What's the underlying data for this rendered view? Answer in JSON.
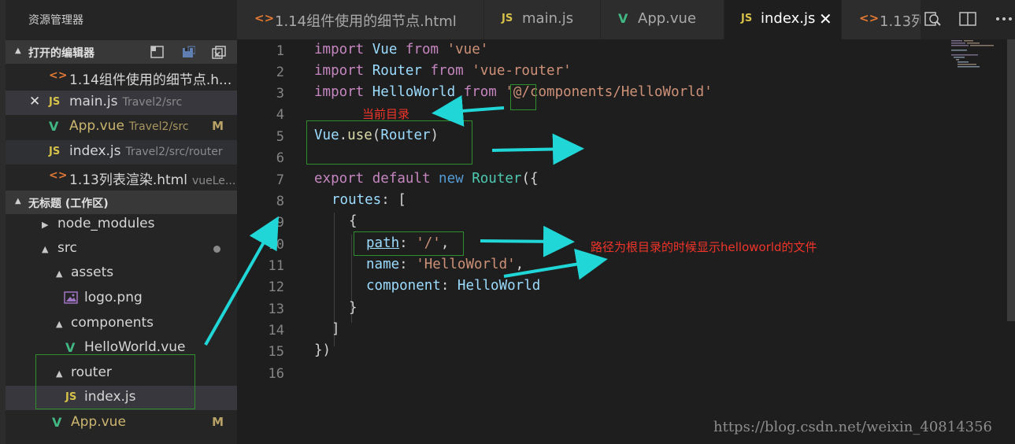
{
  "explorer": {
    "title": "资源管理器",
    "open_editors": {
      "label": "打开的编辑器",
      "items": [
        {
          "icon": "<>",
          "name": "1.14组件使用的细节点.h...",
          "desc": "",
          "badge": ""
        },
        {
          "icon": "JS",
          "name": "main.js",
          "desc": "Travel2/src",
          "badge": ""
        },
        {
          "icon": "V",
          "name": "App.vue",
          "desc": "Travel2/src",
          "badge": "M"
        },
        {
          "icon": "JS",
          "name": "index.js",
          "desc": "Travel2/src/router",
          "badge": ""
        },
        {
          "icon": "<>",
          "name": "1.13列表渲染.html",
          "desc": "vueLe...",
          "badge": ""
        }
      ]
    },
    "workspace": {
      "label": "无标题 (工作区)",
      "tree": [
        {
          "name": "node_modules",
          "expanded": false
        },
        {
          "name": "src",
          "expanded": true
        },
        {
          "name": "assets",
          "expanded": true
        },
        {
          "name": "logo.png",
          "icon": "image-icon"
        },
        {
          "name": "components",
          "expanded": true
        },
        {
          "name": "HelloWorld.vue",
          "icon": "V"
        },
        {
          "name": "router",
          "expanded": true
        },
        {
          "name": "index.js",
          "icon": "JS"
        },
        {
          "name": "App.vue",
          "icon": "V",
          "badge": "M"
        }
      ]
    }
  },
  "tabs": [
    {
      "icon": "<>",
      "label": "1.14组件使用的细节点.html"
    },
    {
      "icon": "JS",
      "label": "main.js"
    },
    {
      "icon": "V",
      "label": "App.vue"
    },
    {
      "icon": "JS",
      "label": "index.js",
      "active": true,
      "close": "✕"
    },
    {
      "icon": "<>",
      "label": "1.13列"
    }
  ],
  "line_numbers": [
    "1",
    "2",
    "3",
    "4",
    "5",
    "6",
    "7",
    "8",
    "9",
    "10",
    "11",
    "12",
    "13",
    "14",
    "15",
    "16"
  ],
  "code": {
    "l1": {
      "k1": "import",
      "id": " Vue ",
      "k2": "from",
      "s": " 'vue'"
    },
    "l2": {
      "k1": "import",
      "id": " Router ",
      "k2": "from",
      "s": " 'vue-router'"
    },
    "l3": {
      "k1": "import",
      "id": " HelloWorld ",
      "k2": "from",
      "s": " '@/components/HelloWorld'"
    },
    "l5": {
      "obj": "Vue",
      "dot": ".",
      "fn": "use",
      "p1": "(",
      "arg": "Router",
      "p2": ")"
    },
    "l7": {
      "k1": "export",
      "k2": " default",
      "k3": " new",
      "cls": " Router",
      "p": "({"
    },
    "l8": {
      "key": "routes",
      "rest": ": ["
    },
    "l9": "{",
    "l10": {
      "key": "path",
      "colon": ": ",
      "s": "'/'",
      "comma": ","
    },
    "l11": {
      "key": "name",
      "colon": ": ",
      "s": "'HelloWorld'",
      "comma": ","
    },
    "l12": {
      "key": "component",
      "colon": ": ",
      "val": "HelloWorld"
    },
    "l13": "}",
    "l14": "]",
    "l15": "})"
  },
  "annotations": {
    "current_dir": "当前目录",
    "root_path": "路径为根目录的时候显示helloworld的文件"
  },
  "watermark": "https://blog.csdn.net/weixin_40814356"
}
